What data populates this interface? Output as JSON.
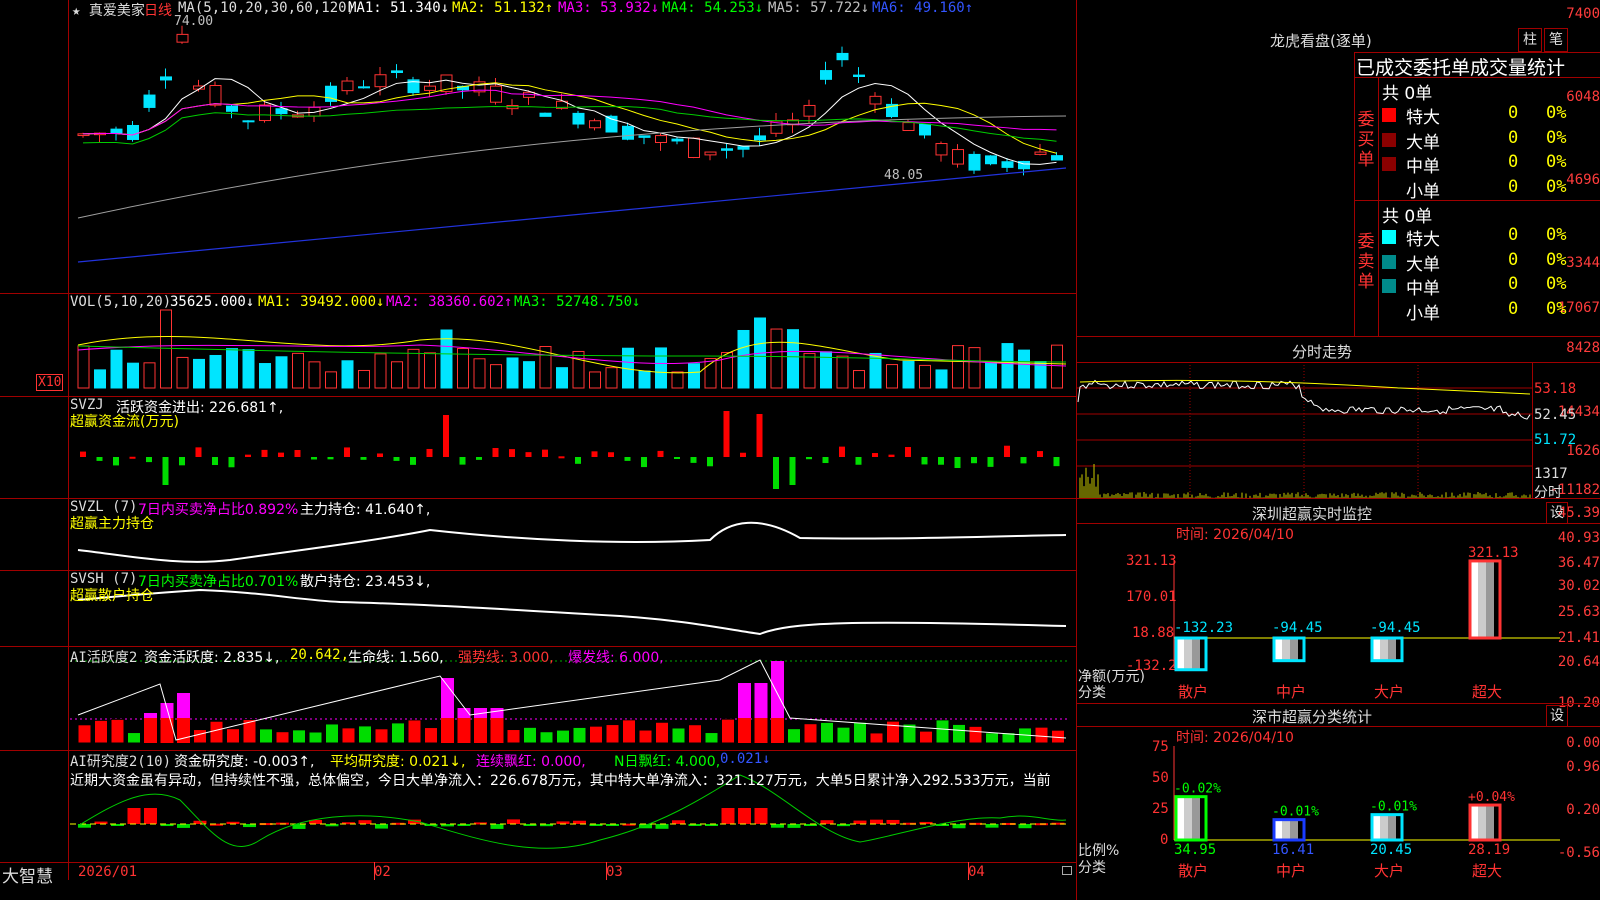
{
  "colors": {
    "up": "#ff3333",
    "down": "#00e5ff",
    "grid": "#a00000",
    "yellow": "#ffff00",
    "magenta": "#ff00ff",
    "green": "#00ff00",
    "white": "#ffffff",
    "bar_green": "#00dd00"
  },
  "main": {
    "stock_name": "★ 真爱美家",
    "period": "日线",
    "ma_legend": "MA(5,10,20,30,60,120)",
    "ma1": "MA1: 51.340↓",
    "ma2": "MA2: 51.132↑",
    "ma3": "MA3: 53.932↓",
    "ma4": "MA4: 54.253↓",
    "ma5": "MA5: 57.722↓",
    "ma6": "MA6: 49.160↑",
    "axis": [
      "7400",
      "6048",
      "4696",
      "3344"
    ],
    "high_mark": "74.00",
    "low_mark": "48.05"
  },
  "vol": {
    "legend": "VOL(5,10,20)",
    "val": "35625.000↓",
    "ma1": "MA1: 39492.000↓",
    "ma2": "MA2: 38360.602↑",
    "ma3": "MA3: 52748.750↓",
    "axis": [
      "17067",
      "8428"
    ],
    "unit": "X10"
  },
  "svzj": {
    "legend": "SVZJ",
    "title": "活跃资金进出: 226.681↑,",
    "sub": "超赢资金流(万元)",
    "axis": [
      "14434",
      "1626",
      "-11182"
    ]
  },
  "svzl": {
    "legend": "SVZL (7)",
    "ratio": "7日内买卖净占比0.892%",
    "hold": "主力持仓: 41.640↑,",
    "sub": "超赢主力持仓",
    "axis": [
      "45.39",
      "40.93",
      "36.47"
    ]
  },
  "svsh": {
    "legend": "SVSH (7)",
    "ratio": "7日内买卖净占比0.701%",
    "hold": "散户持仓: 23.453↓,",
    "sub": "超赢散户持仓",
    "axis": [
      "30.02",
      "25.63",
      "21.41"
    ]
  },
  "ai_act": {
    "legend": "AI活跃度2",
    "a": "资金活跃度: 2.835↓,",
    "b": "20.642,",
    "c": "生命线: 1.560,",
    "d": "强势线: 3.000,",
    "e": "爆发线: 6.000,",
    "axis": [
      "20.64",
      "10.20",
      "0.00"
    ]
  },
  "ai_res": {
    "legend": "AI研究度2(10)",
    "a": "资金研究度: -0.003↑,",
    "b": "平均研究度: 0.021↓,",
    "c": "连续飘红: 0.000,",
    "d": "N日飘红: 4.000,",
    "e": "0.021↓",
    "comment": "近期大资金虽有异动，但持续性不强，总体偏空，今日大单净流入：226.678万元，其中特大单净流入：321.127万元，大单5日累计净入292.533万元，当前",
    "axis": [
      "0.96",
      "0.20",
      "-0.56"
    ]
  },
  "dates": [
    "2026/01",
    "02",
    "03",
    "04"
  ],
  "brand": "大智慧",
  "right": {
    "lhb_title": "龙虎看盘(逐单)",
    "btn_zhu": "柱",
    "btn_bi": "笔",
    "stats_title": "已成交委托单成交量统计",
    "buy_label": "委买单",
    "sell_label": "委卖单",
    "buy_total": "共 0单",
    "sell_total": "共 0单",
    "buy_rows": [
      {
        "name": "特大",
        "n": "0",
        "p": "0%"
      },
      {
        "name": "大单",
        "n": "0",
        "p": "0%"
      },
      {
        "name": "中单",
        "n": "0",
        "p": "0%"
      },
      {
        "name": "小单",
        "n": "0",
        "p": "0%"
      }
    ],
    "sell_rows": [
      {
        "name": "特大",
        "n": "0",
        "p": "0%"
      },
      {
        "name": "大单",
        "n": "0",
        "p": "0%"
      },
      {
        "name": "中单",
        "n": "0",
        "p": "0%"
      },
      {
        "name": "小单",
        "n": "0",
        "p": "0%"
      }
    ],
    "fenshi_title": "分时走势",
    "fenshi_axis": [
      "53.18",
      "52.45",
      "51.72"
    ],
    "fenshi_vol": "1317",
    "fenshi_tag": "分时",
    "sz_title": "深圳超赢实时监控",
    "sz_set": "设",
    "sz_time": "时间: 2026/04/10",
    "sz_axis": [
      "321.13",
      "170.01",
      "18.88",
      "-132.23"
    ],
    "sz_unit": "净额(万元)",
    "sz_cat": "分类",
    "sz_labels": [
      "散户",
      "中户",
      "大户",
      "超大"
    ],
    "sz_values": [
      -132.23,
      -94.45,
      -94.45,
      321.13
    ],
    "sz_value_labels": [
      "-132.23",
      "-94.45",
      "-94.45",
      "321.13"
    ],
    "sh_title": "深市超赢分类统计",
    "sh_set": "设",
    "sh_time": "时间: 2026/04/10",
    "sh_axis": [
      "75",
      "50",
      "25",
      "0"
    ],
    "sh_unit": "比例%",
    "sh_cat": "分类",
    "sh_labels": [
      "散户",
      "中户",
      "大户",
      "超大"
    ],
    "sh_values": [
      34.95,
      16.41,
      20.45,
      28.19
    ],
    "sh_value_labels": [
      "34.95",
      "16.41",
      "20.45",
      "28.19"
    ],
    "sh_changes": [
      "-0.02%",
      "-0.01%",
      "-0.01%",
      "+0.04%"
    ]
  }
}
